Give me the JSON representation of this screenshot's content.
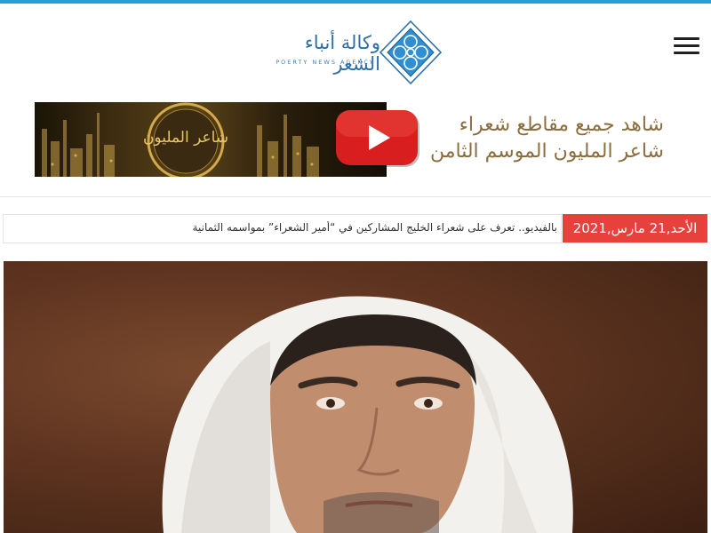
{
  "logo": {
    "title": "وكالة أنباء الشعر",
    "subtitle": "POERTY NEWS AGENCY"
  },
  "banner": {
    "line1": "شاهد جميع مقاطع شعراء",
    "line2": "شاعر المليون الموسم الثامن",
    "image_caption": "شاعر المليون"
  },
  "ticker": {
    "date": "الأحد,21 مارس,2021",
    "headline": "بالفيديو.. تعرف على شعراء الخليج المشاركين في “أمير الشعراء” بمواسمه الثمانية"
  },
  "colors": {
    "accent": "#27a0d8",
    "date_badge": "#e8403a",
    "logo_blue": "#2f6fa8",
    "banner_gold": "#8a6e3e",
    "play_red": "#d81e1e"
  },
  "icons": {
    "menu": "hamburger-menu-icon",
    "play": "youtube-play-icon",
    "logo": "diamond-ornament-logo"
  }
}
